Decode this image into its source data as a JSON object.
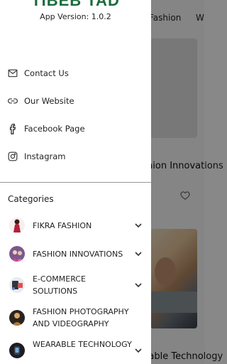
{
  "drawer": {
    "app_name": "TIBEB TAD",
    "app_version": "App Version: 1.0.2",
    "links": [
      {
        "label": "Contact Us",
        "icon": "mail-icon"
      },
      {
        "label": "Our Website",
        "icon": "link-icon"
      },
      {
        "label": "Facebook Page",
        "icon": "facebook-icon"
      },
      {
        "label": "Instagram",
        "icon": "instagram-icon"
      }
    ],
    "categories_title": "Categories",
    "categories": [
      {
        "label": "FIKRA FASHION"
      },
      {
        "label": "FASHION INNOVATIONS"
      },
      {
        "label": "E-COMMERCE SOLUTIONS"
      },
      {
        "label": "FASHION PHOTOGRAPHY AND VIDEOGRAPHY"
      },
      {
        "label": "WEARABLE TECHNOLOGY"
      }
    ]
  },
  "background": {
    "tabs": [
      "Fashion",
      "W"
    ],
    "card_heading": "Fashion Innovations",
    "bottom_heading": "Wearable Technology"
  },
  "colors": {
    "brand_green": "#1a6b3c",
    "scrim": "rgba(0,0,0,0.48)"
  }
}
